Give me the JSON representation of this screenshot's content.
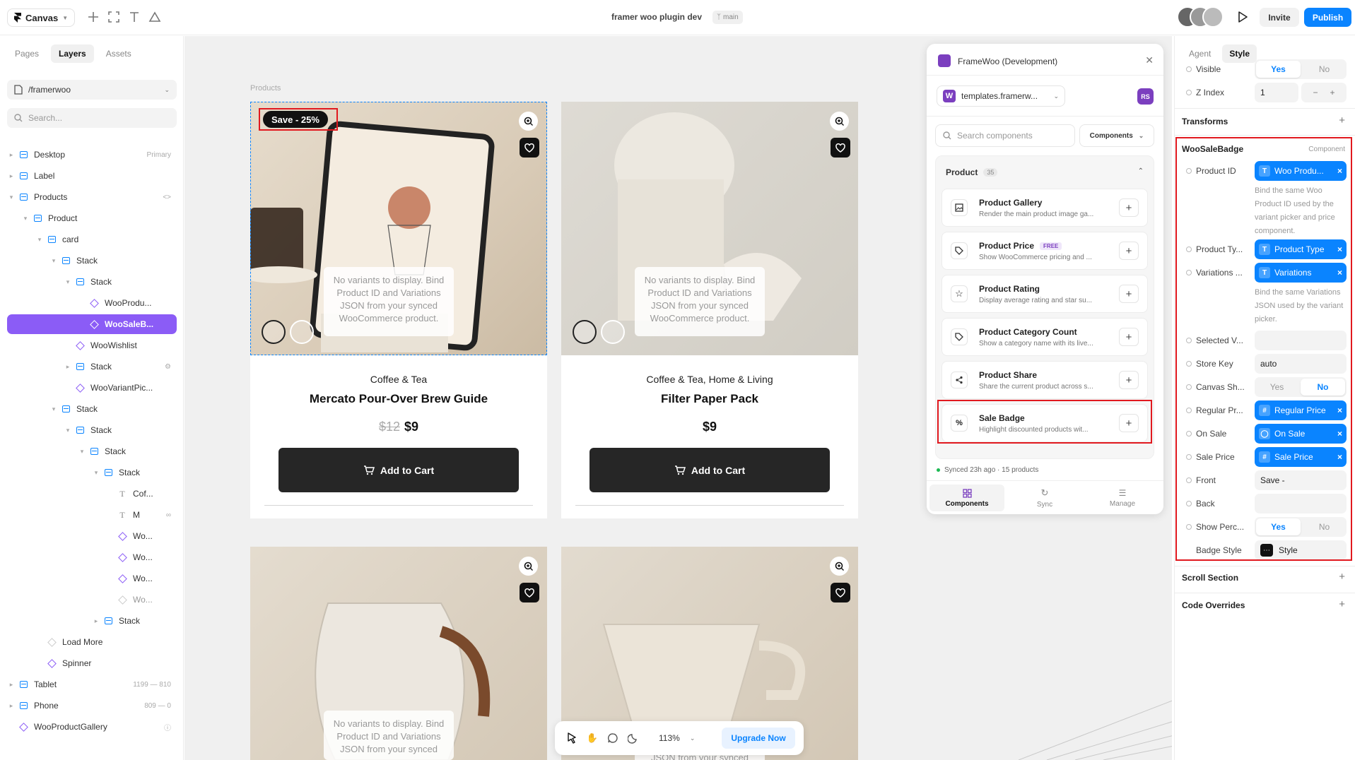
{
  "topbar": {
    "canvas_label": "Canvas",
    "doc_title": "framer woo plugin dev",
    "branch": "main",
    "invite": "Invite",
    "publish": "Publish"
  },
  "left": {
    "tabs": [
      "Pages",
      "Layers",
      "Assets"
    ],
    "path": "/framerwoo",
    "search_placeholder": "Search...",
    "layers": [
      {
        "name": "Desktop",
        "meta": "Primary"
      },
      {
        "name": "Label",
        "meta": ""
      },
      {
        "name": "Products",
        "meta": ""
      },
      {
        "name": "Product",
        "meta": ""
      },
      {
        "name": "card",
        "meta": ""
      },
      {
        "name": "Stack",
        "meta": ""
      },
      {
        "name": "Stack",
        "meta": ""
      },
      {
        "name": "WooProdu...",
        "meta": ""
      },
      {
        "name": "WooSaleB...",
        "meta": ""
      },
      {
        "name": "WooWishlist",
        "meta": ""
      },
      {
        "name": "Stack",
        "meta": ""
      },
      {
        "name": "WooVariantPic...",
        "meta": ""
      },
      {
        "name": "Stack",
        "meta": ""
      },
      {
        "name": "Stack",
        "meta": ""
      },
      {
        "name": "Stack",
        "meta": ""
      },
      {
        "name": "Stack",
        "meta": ""
      },
      {
        "name": "Cof...",
        "meta": ""
      },
      {
        "name": "M",
        "meta": ""
      },
      {
        "name": "Wo...",
        "meta": ""
      },
      {
        "name": "Wo...",
        "meta": ""
      },
      {
        "name": "Wo...",
        "meta": ""
      },
      {
        "name": "Wo...",
        "meta": ""
      },
      {
        "name": "Stack",
        "meta": ""
      },
      {
        "name": "Load More",
        "meta": ""
      },
      {
        "name": "Spinner",
        "meta": ""
      },
      {
        "name": "Tablet",
        "meta": "1199 — 810"
      },
      {
        "name": "Phone",
        "meta": "809 — 0"
      },
      {
        "name": "WooProductGallery",
        "meta": ""
      }
    ]
  },
  "canvas": {
    "frame_label": "Products",
    "no_variants": "No variants to display. Bind Product ID and Variations JSON from your synced WooCommerce product.",
    "products": [
      {
        "badge": "Save - 25%",
        "category": "Coffee & Tea",
        "name": "Mercato Pour-Over Brew Guide",
        "old_price": "$12",
        "price": "$9",
        "cta": "Add to Cart"
      },
      {
        "category": "Coffee & Tea, Home & Living",
        "name": "Filter Paper Pack",
        "price": "$9",
        "cta": "Add to Cart"
      },
      {
        "no_variants": "No variants to display. Bind Product ID and Variations JSON from your synced"
      },
      {
        "no_variants": "JSON from your synced"
      }
    ]
  },
  "plugin": {
    "title": "FrameWoo (Development)",
    "site": "templates.framerw...",
    "avatar": "RS",
    "search_placeholder": "Search components",
    "filter": "Components",
    "section": "Product",
    "count": "35",
    "items": [
      {
        "name": "Product Gallery",
        "desc": "Render the main product image ga...",
        "icon": "image-icon"
      },
      {
        "name": "Product Price",
        "badge": "FREE",
        "desc": "Show WooCommerce pricing and ...",
        "icon": "tag-icon"
      },
      {
        "name": "Product Rating",
        "desc": "Display average rating and star su...",
        "icon": "star-icon"
      },
      {
        "name": "Product Category Count",
        "desc": "Show a category name with its live...",
        "icon": "tag-icon"
      },
      {
        "name": "Product Share",
        "desc": "Share the current product across s...",
        "icon": "share-icon"
      },
      {
        "name": "Sale Badge",
        "desc": "Highlight discounted products wit...",
        "icon": "percent-icon"
      }
    ],
    "synced": "Synced 23h ago · 15 products",
    "tabs": [
      "Components",
      "Sync",
      "Manage"
    ]
  },
  "bottombar": {
    "zoom": "113%",
    "upgrade": "Upgrade Now"
  },
  "right": {
    "tabs": [
      "Agent",
      "Style"
    ],
    "visible_label": "Visible",
    "yes": "Yes",
    "no": "No",
    "zindex_label": "Z Index",
    "zindex_value": "1",
    "transforms": "Transforms",
    "component_title": "WooSaleBadge",
    "component_tag": "Component",
    "product_id_label": "Product ID",
    "product_id_value": "Woo Produ...",
    "product_id_help": "Bind the same Woo Product ID used by the variant picker and price component.",
    "product_type_label": "Product Ty...",
    "product_type_value": "Product Type",
    "variations_label": "Variations ...",
    "variations_value": "Variations",
    "variations_help": "Bind the same Variations JSON used by the variant picker.",
    "selected_label": "Selected V...",
    "store_key_label": "Store Key",
    "store_key_value": "auto",
    "canvas_label": "Canvas Sh...",
    "regular_label": "Regular Pr...",
    "regular_value": "Regular Price",
    "onsale_label": "On Sale",
    "onsale_value": "On Sale",
    "saleprice_label": "Sale Price",
    "saleprice_value": "Sale Price",
    "front_label": "Front",
    "front_value": "Save -",
    "back_label": "Back",
    "showperc_label": "Show Perc...",
    "badgestyle_label": "Badge Style",
    "badgestyle_value": "Style",
    "scroll_section": "Scroll Section",
    "code_overrides": "Code Overrides"
  },
  "colors": {
    "accent": "#0a84ff",
    "selection": "#8b5cf6",
    "highlight": "#e1191f",
    "plugin_brand": "#7b3fbf"
  }
}
